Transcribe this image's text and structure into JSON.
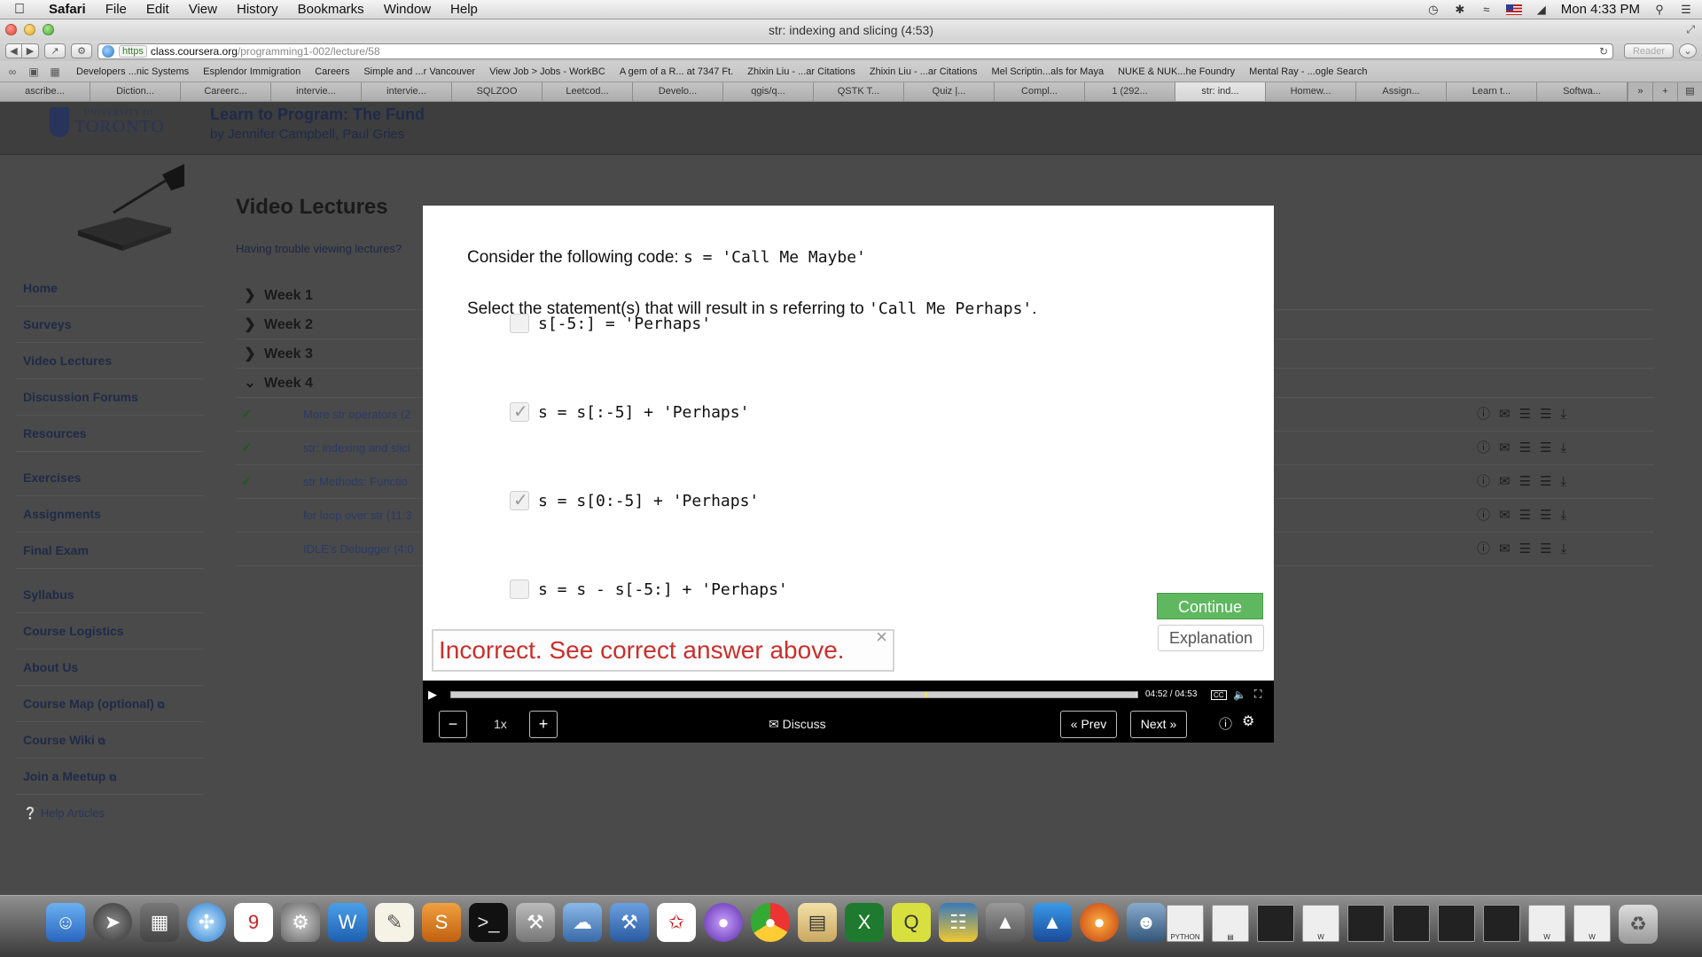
{
  "menubar": {
    "app": "Safari",
    "items": [
      "File",
      "Edit",
      "View",
      "History",
      "Bookmarks",
      "Window",
      "Help"
    ],
    "clock": "Mon 4:33 PM"
  },
  "window": {
    "title": "str: indexing and slicing (4:53)"
  },
  "toolbar": {
    "url_https": "https",
    "url_domain": "class.coursera.org",
    "url_path": "/programming1-002/lecture/58",
    "reader": "Reader"
  },
  "bookmarks": [
    "Developers ...nic Systems",
    "Esplendor Immigration",
    "Careers",
    "Simple and ...r Vancouver",
    "View Job > Jobs - WorkBC",
    "A gem of a R... at 7347 Ft.",
    "Zhixin Liu - ...ar Citations",
    "Zhixin Liu - ...ar Citations",
    "Mel Scriptin...als for Maya",
    "NUKE & NUK...he Foundry",
    "Mental Ray - ...ogle Search"
  ],
  "tabs": [
    "ascribe...",
    "Diction...",
    "Careerc...",
    "intervie...",
    "intervie...",
    "SQLZOO",
    "Leetcod...",
    "Develo...",
    "qgis/q...",
    "QSTK T...",
    "Quiz |...",
    "Compl...",
    "1 (292...",
    "str: ind...",
    "Homew...",
    "Assign...",
    "Learn t...",
    "Softwa..."
  ],
  "site": {
    "logo_small": "UNIVERSITY OF",
    "logo_big": "TORONTO",
    "course_title": "Learn to Program: The Fund",
    "course_instructors": "by Jennifer Campbell, Paul Gries"
  },
  "sidebar": {
    "items": [
      {
        "label": "Home"
      },
      {
        "label": "Surveys"
      },
      {
        "label": "Video Lectures"
      },
      {
        "label": "Discussion Forums"
      },
      {
        "label": "Resources"
      },
      {
        "label": "Exercises"
      },
      {
        "label": "Assignments"
      },
      {
        "label": "Final Exam"
      },
      {
        "label": "Syllabus"
      },
      {
        "label": "Course Logistics"
      },
      {
        "label": "About Us"
      },
      {
        "label": "Course Map (optional)"
      },
      {
        "label": "Course Wiki"
      },
      {
        "label": "Join a Meetup"
      }
    ],
    "help": "Help Articles"
  },
  "main": {
    "heading": "Video Lectures",
    "trouble": "Having trouble viewing lectures?",
    "weeks": [
      "Week 1",
      "Week 2",
      "Week 3",
      "Week 4"
    ],
    "lectures": [
      {
        "title": "More str operators (2",
        "done": true
      },
      {
        "title": "str: indexing and slici",
        "done": true
      },
      {
        "title": "str Methods: Functio",
        "done": true
      },
      {
        "title": "for loop over str (11:3",
        "done": false
      },
      {
        "title": "IDLE's Debugger (4:0",
        "done": false
      }
    ]
  },
  "quiz": {
    "prompt_text": "Consider the following code: ",
    "prompt_code": "s = 'Call Me Maybe'",
    "question_pre": "Select the statement(s) that will result in s referring to ",
    "question_code": "'Call Me Perhaps'",
    "question_post": ".",
    "options": [
      {
        "code": "s[-5:] = 'Perhaps'",
        "checked": false
      },
      {
        "code": "s = s[:-5] + 'Perhaps'",
        "checked": true
      },
      {
        "code": "s = s[0:-5] + 'Perhaps'",
        "checked": true
      },
      {
        "code": "s = s - s[-5:] + 'Perhaps'",
        "checked": false
      }
    ],
    "continue_label": "Continue",
    "explanation_label": "Explanation",
    "feedback": "Incorrect. See correct answer above.",
    "feedback_close": "×"
  },
  "player": {
    "time": "04:52 / 04:53",
    "progress": 0.997,
    "speed": "1x",
    "minus": "−",
    "plus": "+",
    "discuss": "Discuss",
    "prev": "« Prev",
    "next": "Next »",
    "cc": "CC"
  }
}
